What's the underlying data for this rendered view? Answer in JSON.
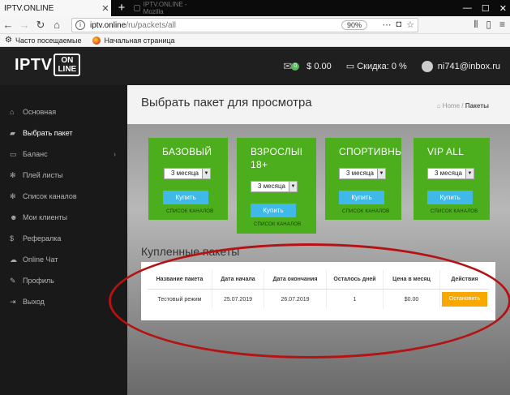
{
  "browser": {
    "active_tab_title": "IPTV.ONLINE",
    "inactive_tab_title": "IPTV.ONLINE - Mozilla",
    "url_host": "iptv.online",
    "url_path": "/ru/packets/all",
    "zoom": "90%",
    "bookmarks": [
      "Часто посещаемые",
      "Начальная страница"
    ]
  },
  "header": {
    "logo_main": "IPTV",
    "logo_top": "ON",
    "logo_bottom": "LINE",
    "mail_count": "0",
    "balance": "$ 0.00",
    "discount": "Скидка: 0 %",
    "user_email": "ni741@inbox.ru"
  },
  "sidebar": {
    "items": [
      {
        "label": "Основная",
        "icon": "home-icon"
      },
      {
        "label": "Выбрать пакет",
        "icon": "cart-icon"
      },
      {
        "label": "Баланс",
        "icon": "card-icon"
      },
      {
        "label": "Плей листы",
        "icon": "gear-icon"
      },
      {
        "label": "Список каналов",
        "icon": "gear-icon"
      },
      {
        "label": "Мои клиенты",
        "icon": "users-icon"
      },
      {
        "label": "Рефералка",
        "icon": "dollar-icon"
      },
      {
        "label": "Online Чат",
        "icon": "chat-icon"
      },
      {
        "label": "Профиль",
        "icon": "edit-icon"
      },
      {
        "label": "Выход",
        "icon": "logout-icon"
      }
    ]
  },
  "main": {
    "title": "Выбрать пакет для просмотра",
    "breadcrumb_home": "Home",
    "breadcrumb_current": "Пакеты",
    "packages": [
      {
        "name": "БАЗОВЫЙ",
        "period": "3 месяца",
        "buy_label": "Купить",
        "channels_link": "СПИСОК КАНАЛОВ"
      },
      {
        "name": "ВЗРОСЛЫЙ 18+",
        "period": "3 месяца",
        "buy_label": "Купить",
        "channels_link": "СПИСОК КАНАЛОВ"
      },
      {
        "name": "СПОРТИВНЫЙ",
        "period": "3 месяца",
        "buy_label": "Купить",
        "channels_link": "СПИСОК КАНАЛОВ"
      },
      {
        "name": "VIP ALL",
        "period": "3 месяца",
        "buy_label": "Купить",
        "channels_link": "СПИСОК КАНАЛОВ"
      }
    ],
    "purchased_title": "Купленные пакеты",
    "table": {
      "columns": [
        "Название пакета",
        "Дата начала",
        "Дата окончания",
        "Осталось дней",
        "Цена в месяц",
        "Действия"
      ],
      "rows": [
        {
          "name": "Тестовый режим",
          "start": "25.07.2019",
          "end": "26.07.2019",
          "days_left": "1",
          "price": "$0.00",
          "action": "Остановить"
        }
      ]
    }
  },
  "colors": {
    "package_green": "#4cae1d",
    "buy_blue": "#40b8e8",
    "stop_orange": "#f9a800",
    "annotation_red": "#b51214"
  }
}
